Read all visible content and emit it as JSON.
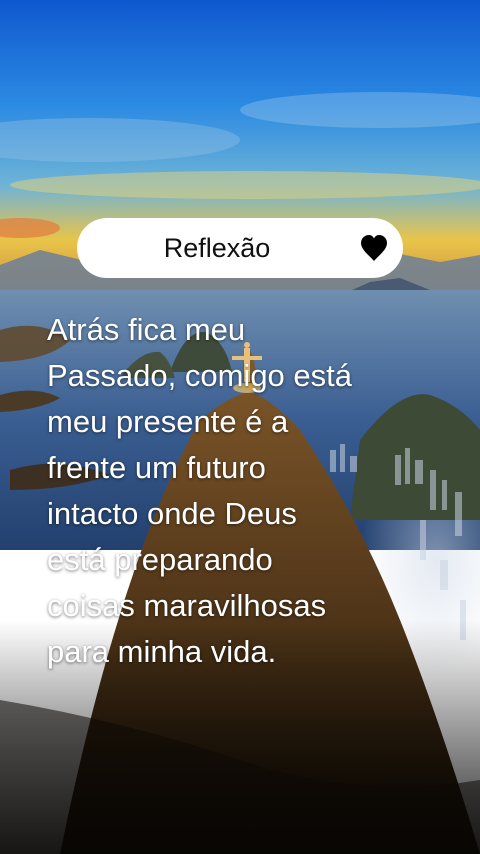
{
  "header": {
    "title": "Reflexão",
    "icon": "heart-icon",
    "pill_color": "#ffffff",
    "icon_color": "#000000"
  },
  "quote": {
    "lines": [
      "Atrás fica meu",
      "Passado, comigo está",
      "meu presente é a",
      "frente um futuro",
      "intacto onde Deus",
      "está preparando",
      "coisas maravilhosas",
      "para minha vida."
    ],
    "color": "#ffffff"
  },
  "background": {
    "sky_top": "#1e6bd6",
    "sky_glow": "#f5c23a",
    "sea": "#2c4f86",
    "mountain": "#5b3a1c"
  }
}
